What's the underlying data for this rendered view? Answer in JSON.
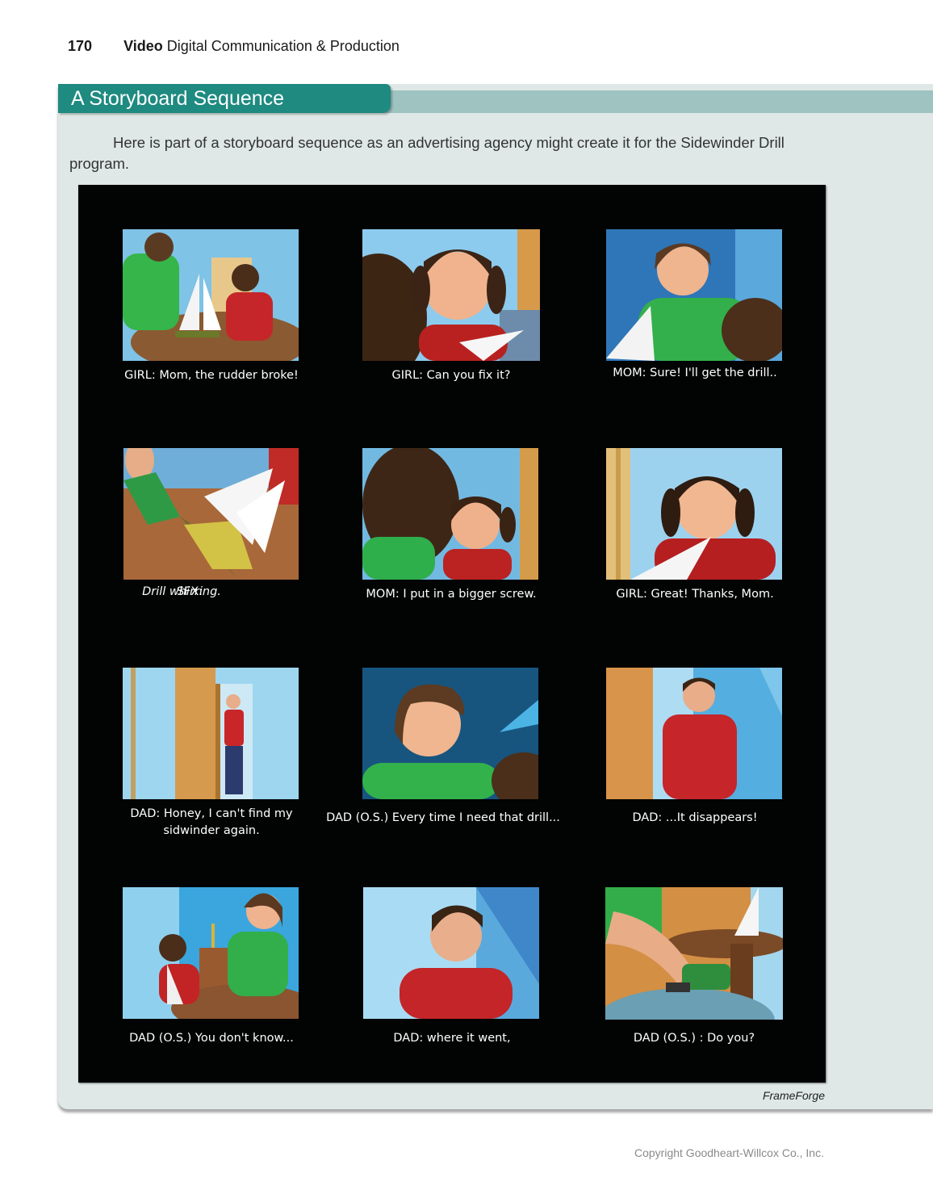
{
  "header": {
    "page_number": "170",
    "section": "Video",
    "book_title": "Digital Communication & Production"
  },
  "sidebar_box": {
    "title": "A Storyboard Sequence",
    "intro": "Here is part of a storyboard sequence as an advertising agency might create it for the Sidewinder Drill program."
  },
  "storyboard": {
    "panels": [
      {
        "caption": "GIRL: Mom, the rudder broke!"
      },
      {
        "caption": "GIRL: Can you fix it?"
      },
      {
        "caption": "MOM: Sure! I'll get the drill.."
      },
      {
        "caption_prefix": "SFX: ",
        "caption_italic": "Drill whirring."
      },
      {
        "caption": "MOM: I put in a bigger screw."
      },
      {
        "caption": "GIRL: Great! Thanks, Mom."
      },
      {
        "caption": "DAD: Honey, I can't find my sidwinder again."
      },
      {
        "caption": "DAD (O.S.) Every time I need that drill..."
      },
      {
        "caption": "DAD: ...It disappears!"
      },
      {
        "caption": "DAD (O.S.) You don't know..."
      },
      {
        "caption": "DAD: where it went,"
      },
      {
        "caption": "DAD (O.S.) : Do you?"
      }
    ],
    "credit": "FrameForge"
  },
  "footer": {
    "copyright": "Copyright Goodheart-Willcox Co., Inc."
  }
}
